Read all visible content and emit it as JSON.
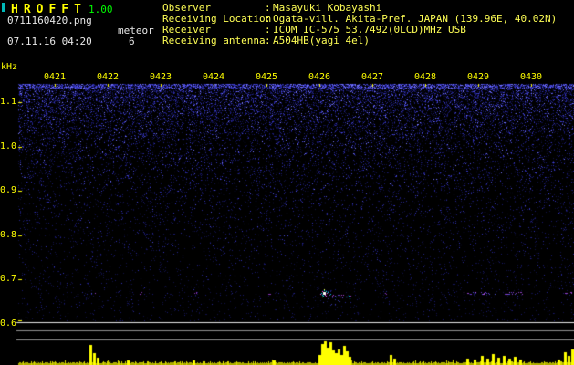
{
  "header": {
    "app_name": "HROFFT",
    "version": "1.00",
    "filename": "0711160420.png",
    "mode": "meteor",
    "count": "6",
    "datetime": "07.11.16 04:20",
    "sep": ":",
    "info": [
      {
        "label": "Observer",
        "value": "Masayuki Kobayashi"
      },
      {
        "label": "Receiving Location",
        "value": "Ogata-vill. Akita-Pref. JAPAN (139.96E, 40.02N)"
      },
      {
        "label": "Receiver",
        "value": "ICOM IC-575 53.7492(0LCD)MHz USB"
      },
      {
        "label": "Receiving antenna",
        "value": "A504HB(yagi 4el)"
      }
    ]
  },
  "colors": {
    "axis_text": "#ffff00",
    "version_text": "#00ff00",
    "info_text": "#ffff55",
    "noise_blue": "#2a2aa0",
    "echo_purple": "#a040d0",
    "echo_strong_core": "#ffffff",
    "echo_strong_halo": "#00e8ff",
    "power_trace": "#ffff00"
  },
  "chart_data": {
    "type": "heatmap",
    "title": "HROFFT radio meteor spectrogram 07.11.16 04:20",
    "x_axis": {
      "labels": [
        "0421",
        "0422",
        "0423",
        "0424",
        "0425",
        "0426",
        "0427",
        "0428",
        "0429",
        "0430"
      ],
      "unit": "hhmm"
    },
    "y_axis": {
      "unit": "kHz",
      "labels": [
        "1.1",
        "1.0",
        "0.9",
        "0.8",
        "0.7",
        "0.6"
      ],
      "range_khz": [
        0.6,
        1.2
      ]
    },
    "meteor_count": 6,
    "echoes": [
      {
        "t": 21.69,
        "time": "04:21.7",
        "freq_khz": 0.67,
        "strength": "weak"
      },
      {
        "t": 22.64,
        "time": "04:22.6",
        "freq_khz": 0.67,
        "strength": "faint"
      },
      {
        "t": 23.67,
        "time": "04:23.7",
        "freq_khz": 0.67,
        "strength": "faint"
      },
      {
        "t": 25.05,
        "time": "04:25.1",
        "freq_khz": 0.67,
        "strength": "faint"
      },
      {
        "t": 26.08,
        "time": "04:26.1",
        "freq_khz": 0.67,
        "strength": "strong",
        "duration_min": 0.5
      },
      {
        "t": 27.25,
        "time": "04:27.3",
        "freq_khz": 0.67,
        "strength": "faint"
      },
      {
        "t": 28.72,
        "time": "04:28.7",
        "freq_khz": 0.67,
        "strength": "weak",
        "duration_min": 0.6
      },
      {
        "t": 29.5,
        "time": "04:29.5",
        "freq_khz": 0.67,
        "strength": "weak",
        "duration_min": 0.35
      },
      {
        "t": 30.6,
        "time": "04:30.6",
        "freq_khz": 0.67,
        "strength": "weak",
        "duration_min": 0.2
      }
    ],
    "power_spikes": [
      [
        21.67,
        21
      ],
      [
        21.74,
        12
      ],
      [
        21.81,
        7
      ],
      [
        22.38,
        4
      ],
      [
        23.62,
        4
      ],
      [
        25.14,
        4
      ],
      [
        26.0,
        10
      ],
      [
        26.05,
        22
      ],
      [
        26.1,
        25
      ],
      [
        26.16,
        18
      ],
      [
        26.21,
        24
      ],
      [
        26.26,
        15
      ],
      [
        26.31,
        12
      ],
      [
        26.36,
        16
      ],
      [
        26.41,
        10
      ],
      [
        26.47,
        20
      ],
      [
        26.52,
        14
      ],
      [
        26.57,
        8
      ],
      [
        27.34,
        10
      ],
      [
        27.41,
        6
      ],
      [
        28.79,
        6
      ],
      [
        28.93,
        5
      ],
      [
        29.07,
        9
      ],
      [
        29.17,
        6
      ],
      [
        29.28,
        11
      ],
      [
        29.38,
        7
      ],
      [
        29.48,
        9
      ],
      [
        29.59,
        6
      ],
      [
        29.69,
        8
      ],
      [
        29.79,
        5
      ],
      [
        30.52,
        5
      ],
      [
        30.64,
        13
      ],
      [
        30.71,
        9
      ],
      [
        30.78,
        16
      ]
    ]
  }
}
